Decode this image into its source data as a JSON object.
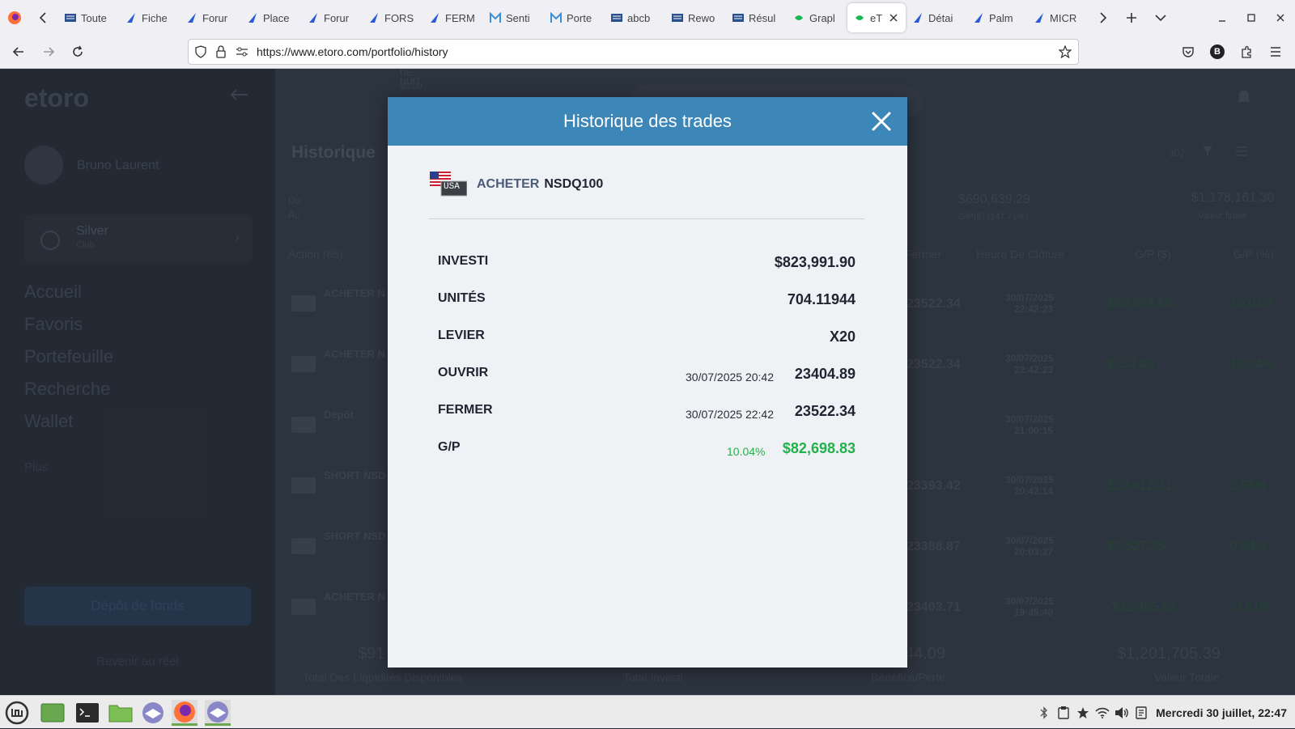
{
  "browser": {
    "url": "https://www.etoro.com/portfolio/history",
    "tabs": [
      {
        "label": "Toute",
        "icon": "abc-news-icon"
      },
      {
        "label": "Fiche",
        "icon": "abc-bourse-icon"
      },
      {
        "label": "Forur",
        "icon": "abc-bourse-icon"
      },
      {
        "label": "Place",
        "icon": "abc-bourse-icon"
      },
      {
        "label": "Forur",
        "icon": "abc-bourse-icon"
      },
      {
        "label": "FORS",
        "icon": "abc-bourse-icon"
      },
      {
        "label": "FERM",
        "icon": "abc-bourse-icon"
      },
      {
        "label": "Senti",
        "icon": "m-icon"
      },
      {
        "label": "Porte",
        "icon": "m-icon"
      },
      {
        "label": "abcb",
        "icon": "abc-news-icon"
      },
      {
        "label": "Rewo",
        "icon": "abc-news-icon"
      },
      {
        "label": "Résul",
        "icon": "abc-news-icon"
      },
      {
        "label": "Grapl",
        "icon": "etoro-icon"
      },
      {
        "label": "eT",
        "icon": "etoro-icon",
        "active": true
      },
      {
        "label": "Détai",
        "icon": "abc-bourse-icon"
      },
      {
        "label": "Palm",
        "icon": "abc-bourse-icon"
      },
      {
        "label": "MICR",
        "icon": "abc-bourse-icon"
      }
    ]
  },
  "background": {
    "brand": "etoro",
    "user_name": "Bruno Laurent",
    "tier": "Silver",
    "tier_sub": "Club",
    "nav": [
      "Accueil",
      "Favoris",
      "Portefeuille",
      "Recherche",
      "Wallet"
    ],
    "more": "Plus",
    "deposit_button": "Dépôt de fonds",
    "return_link": "Revenir au réel",
    "page_title": "Historique",
    "night_label": "DE\nNUIT",
    "night_value": "$0.00",
    "period": "30J",
    "date_from_label": "Du",
    "date_to_label": "Au",
    "gp_total": "$690,639.29",
    "gp_sub": "G/P($) (147.71%)",
    "final_value": "$1,178,161.30",
    "final_value_label": "Valeur finale",
    "columns": [
      "Action (65)",
      "Fermer",
      "Heure De Clôture",
      "G/P ($)",
      "G/P (%)"
    ],
    "rows": [
      {
        "action": "ACHETER N",
        "close": "23522.34",
        "date": "30/07/2025",
        "time": "22:42:23",
        "gp": "$82,698.83",
        "gp_pct": "10.04%"
      },
      {
        "action": "ACHETER N",
        "close": "23522.34",
        "date": "30/07/2025",
        "time": "22:42:23",
        "gp": "$154.40",
        "gp_pct": "10.74%"
      },
      {
        "action": "Dépôt",
        "close": "",
        "date": "30/07/2025",
        "time": "21:00:15",
        "gp": "",
        "gp_pct": ""
      },
      {
        "action": "SHORT NSD",
        "close": "23393.42",
        "date": "30/07/2025",
        "time": "20:42:14",
        "gp": "$20,612.31",
        "gp_pct": "2.56%"
      },
      {
        "action": "SHORT NSD",
        "close": "23388.87",
        "date": "30/07/2025",
        "time": "20:03:27",
        "gp": "$7,527.25",
        "gp_pct": "0.94%"
      },
      {
        "action": "ACHETER N",
        "close": "23403.71",
        "date": "30/07/2025",
        "time": "19:45:40",
        "gp": "-$32,365.02",
        "gp_pct": "-3.91%"
      }
    ],
    "footer": {
      "cash": "$91",
      "cash_label": "Total Des Liquidités Disponibles",
      "invested_label": "Total Investi",
      "pl": "44.09",
      "pl_label": "Bénéfice/Perte",
      "total": "$1,201,705.39",
      "total_label": "Valeur Totale"
    }
  },
  "modal": {
    "title": "Historique des trades",
    "flag_text": "USA",
    "action": "ACHETER",
    "symbol": "NSDQ100",
    "rows": {
      "invested": {
        "label": "INVESTI",
        "value": "$823,991.90"
      },
      "units": {
        "label": "UNITÉS",
        "value": "704.11944"
      },
      "leverage": {
        "label": "LEVIER",
        "value": "X20"
      },
      "open": {
        "label": "OUVRIR",
        "datetime": "30/07/2025 20:42",
        "value": "23404.89"
      },
      "close": {
        "label": "FERMER",
        "datetime": "30/07/2025 22:42",
        "value": "23522.34"
      },
      "pl": {
        "label": "G/P",
        "percent": "10.04%",
        "value": "$82,698.83"
      }
    },
    "colors": {
      "header": "#3d86b8",
      "profit": "#21b24b"
    }
  },
  "taskbar": {
    "clock": "Mercredi 30 juillet, 22:47"
  }
}
